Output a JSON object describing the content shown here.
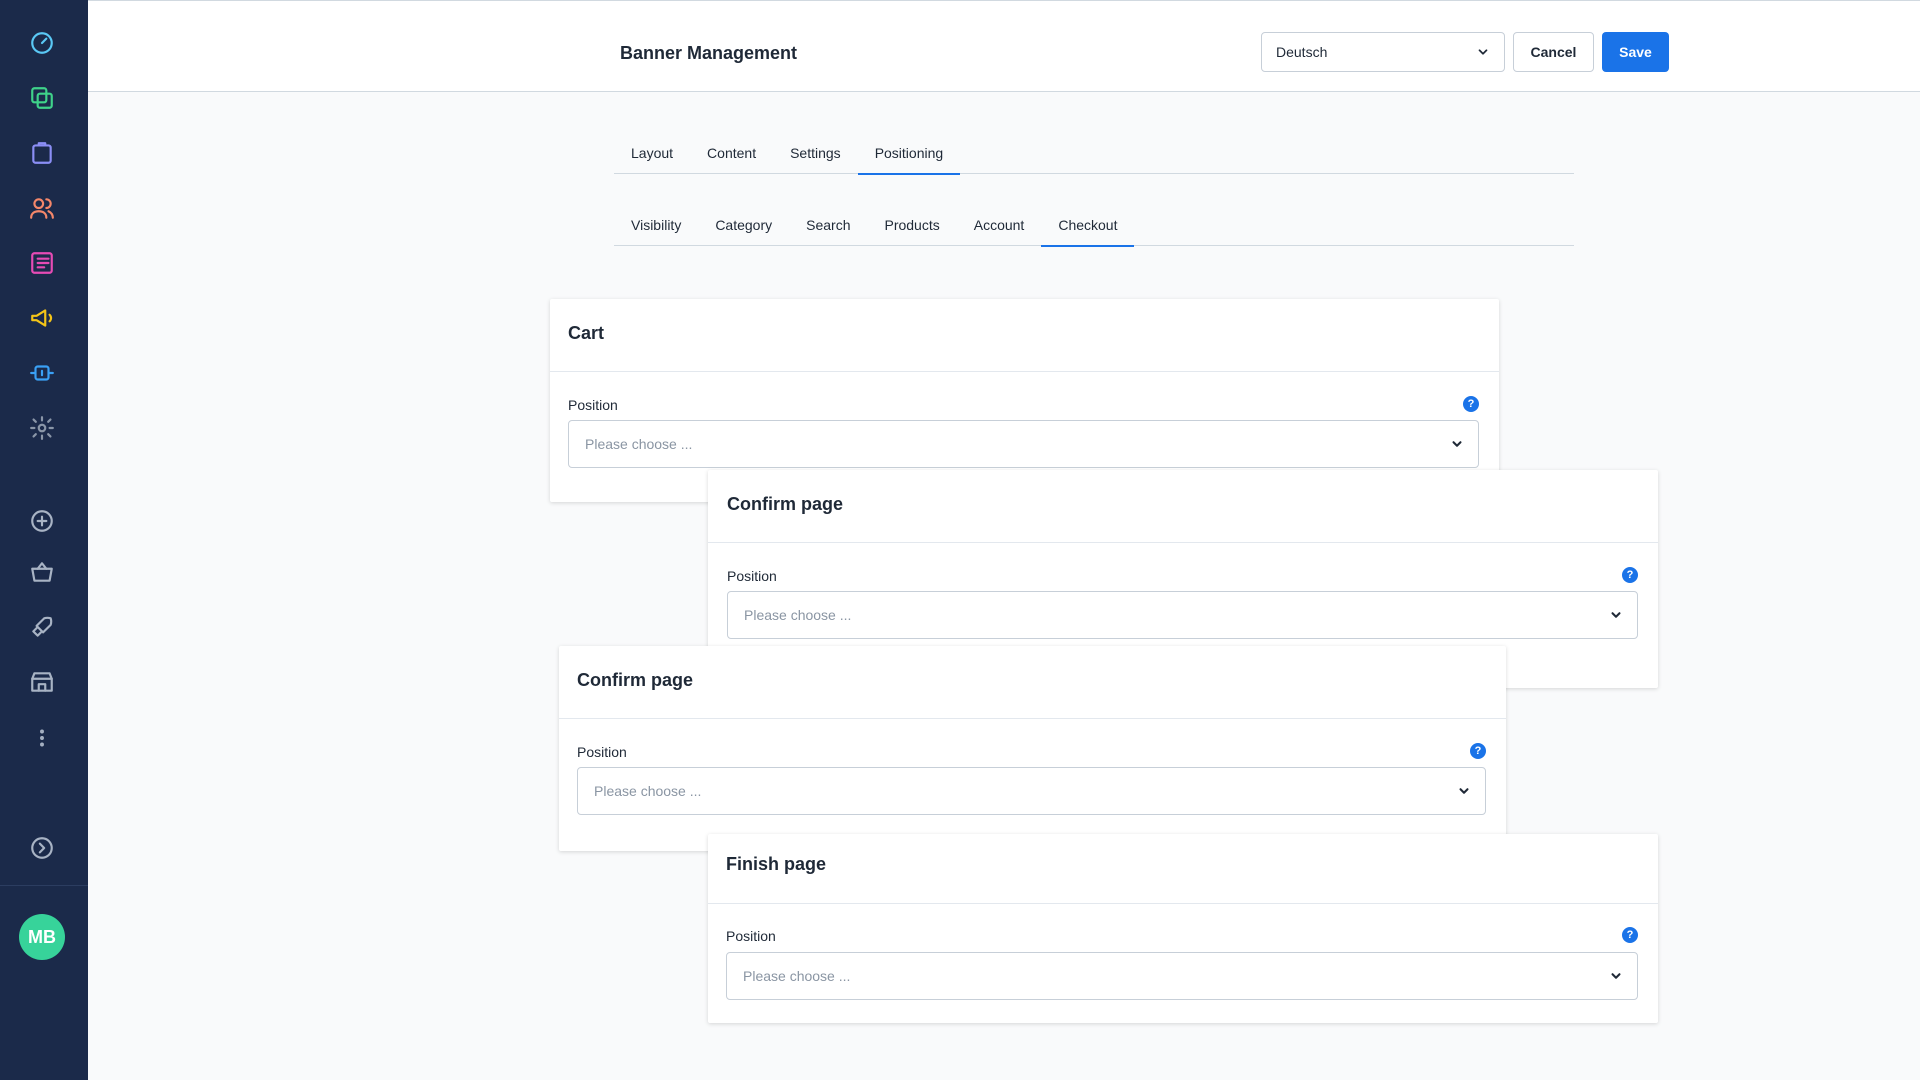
{
  "header": {
    "title": "Banner Management",
    "language": "Deutsch",
    "cancel_label": "Cancel",
    "save_label": "Save"
  },
  "main_tabs": [
    {
      "label": "Layout",
      "active": false
    },
    {
      "label": "Content",
      "active": false
    },
    {
      "label": "Settings",
      "active": false
    },
    {
      "label": "Positioning",
      "active": true
    }
  ],
  "sub_tabs": [
    {
      "label": "Visibility",
      "active": false
    },
    {
      "label": "Category",
      "active": false
    },
    {
      "label": "Search",
      "active": false
    },
    {
      "label": "Products",
      "active": false
    },
    {
      "label": "Account",
      "active": false
    },
    {
      "label": "Checkout",
      "active": true
    }
  ],
  "cards": [
    {
      "title": "Cart",
      "field_label": "Position",
      "placeholder": "Please choose ..."
    },
    {
      "title": "Confirm page",
      "field_label": "Position",
      "placeholder": "Please choose ..."
    },
    {
      "title": "Confirm page",
      "field_label": "Position",
      "placeholder": "Please choose ..."
    },
    {
      "title": "Finish page",
      "field_label": "Position",
      "placeholder": "Please choose ..."
    }
  ],
  "help_glyph": "?",
  "sidebar": {
    "icons": [
      "dashboard-icon",
      "catalogue-icon",
      "orders-icon",
      "customers-icon",
      "content-icon",
      "marketing-icon",
      "extensions-icon",
      "settings-icon",
      "add-icon",
      "basket-icon",
      "rocket-icon",
      "storefront-icon",
      "more-icon",
      "collapse-icon"
    ],
    "avatar_initials": "MB"
  },
  "colors": {
    "primary": "#1a73e8",
    "sidebar_bg": "#1b2a4a",
    "avatar_bg": "#37d39a"
  }
}
